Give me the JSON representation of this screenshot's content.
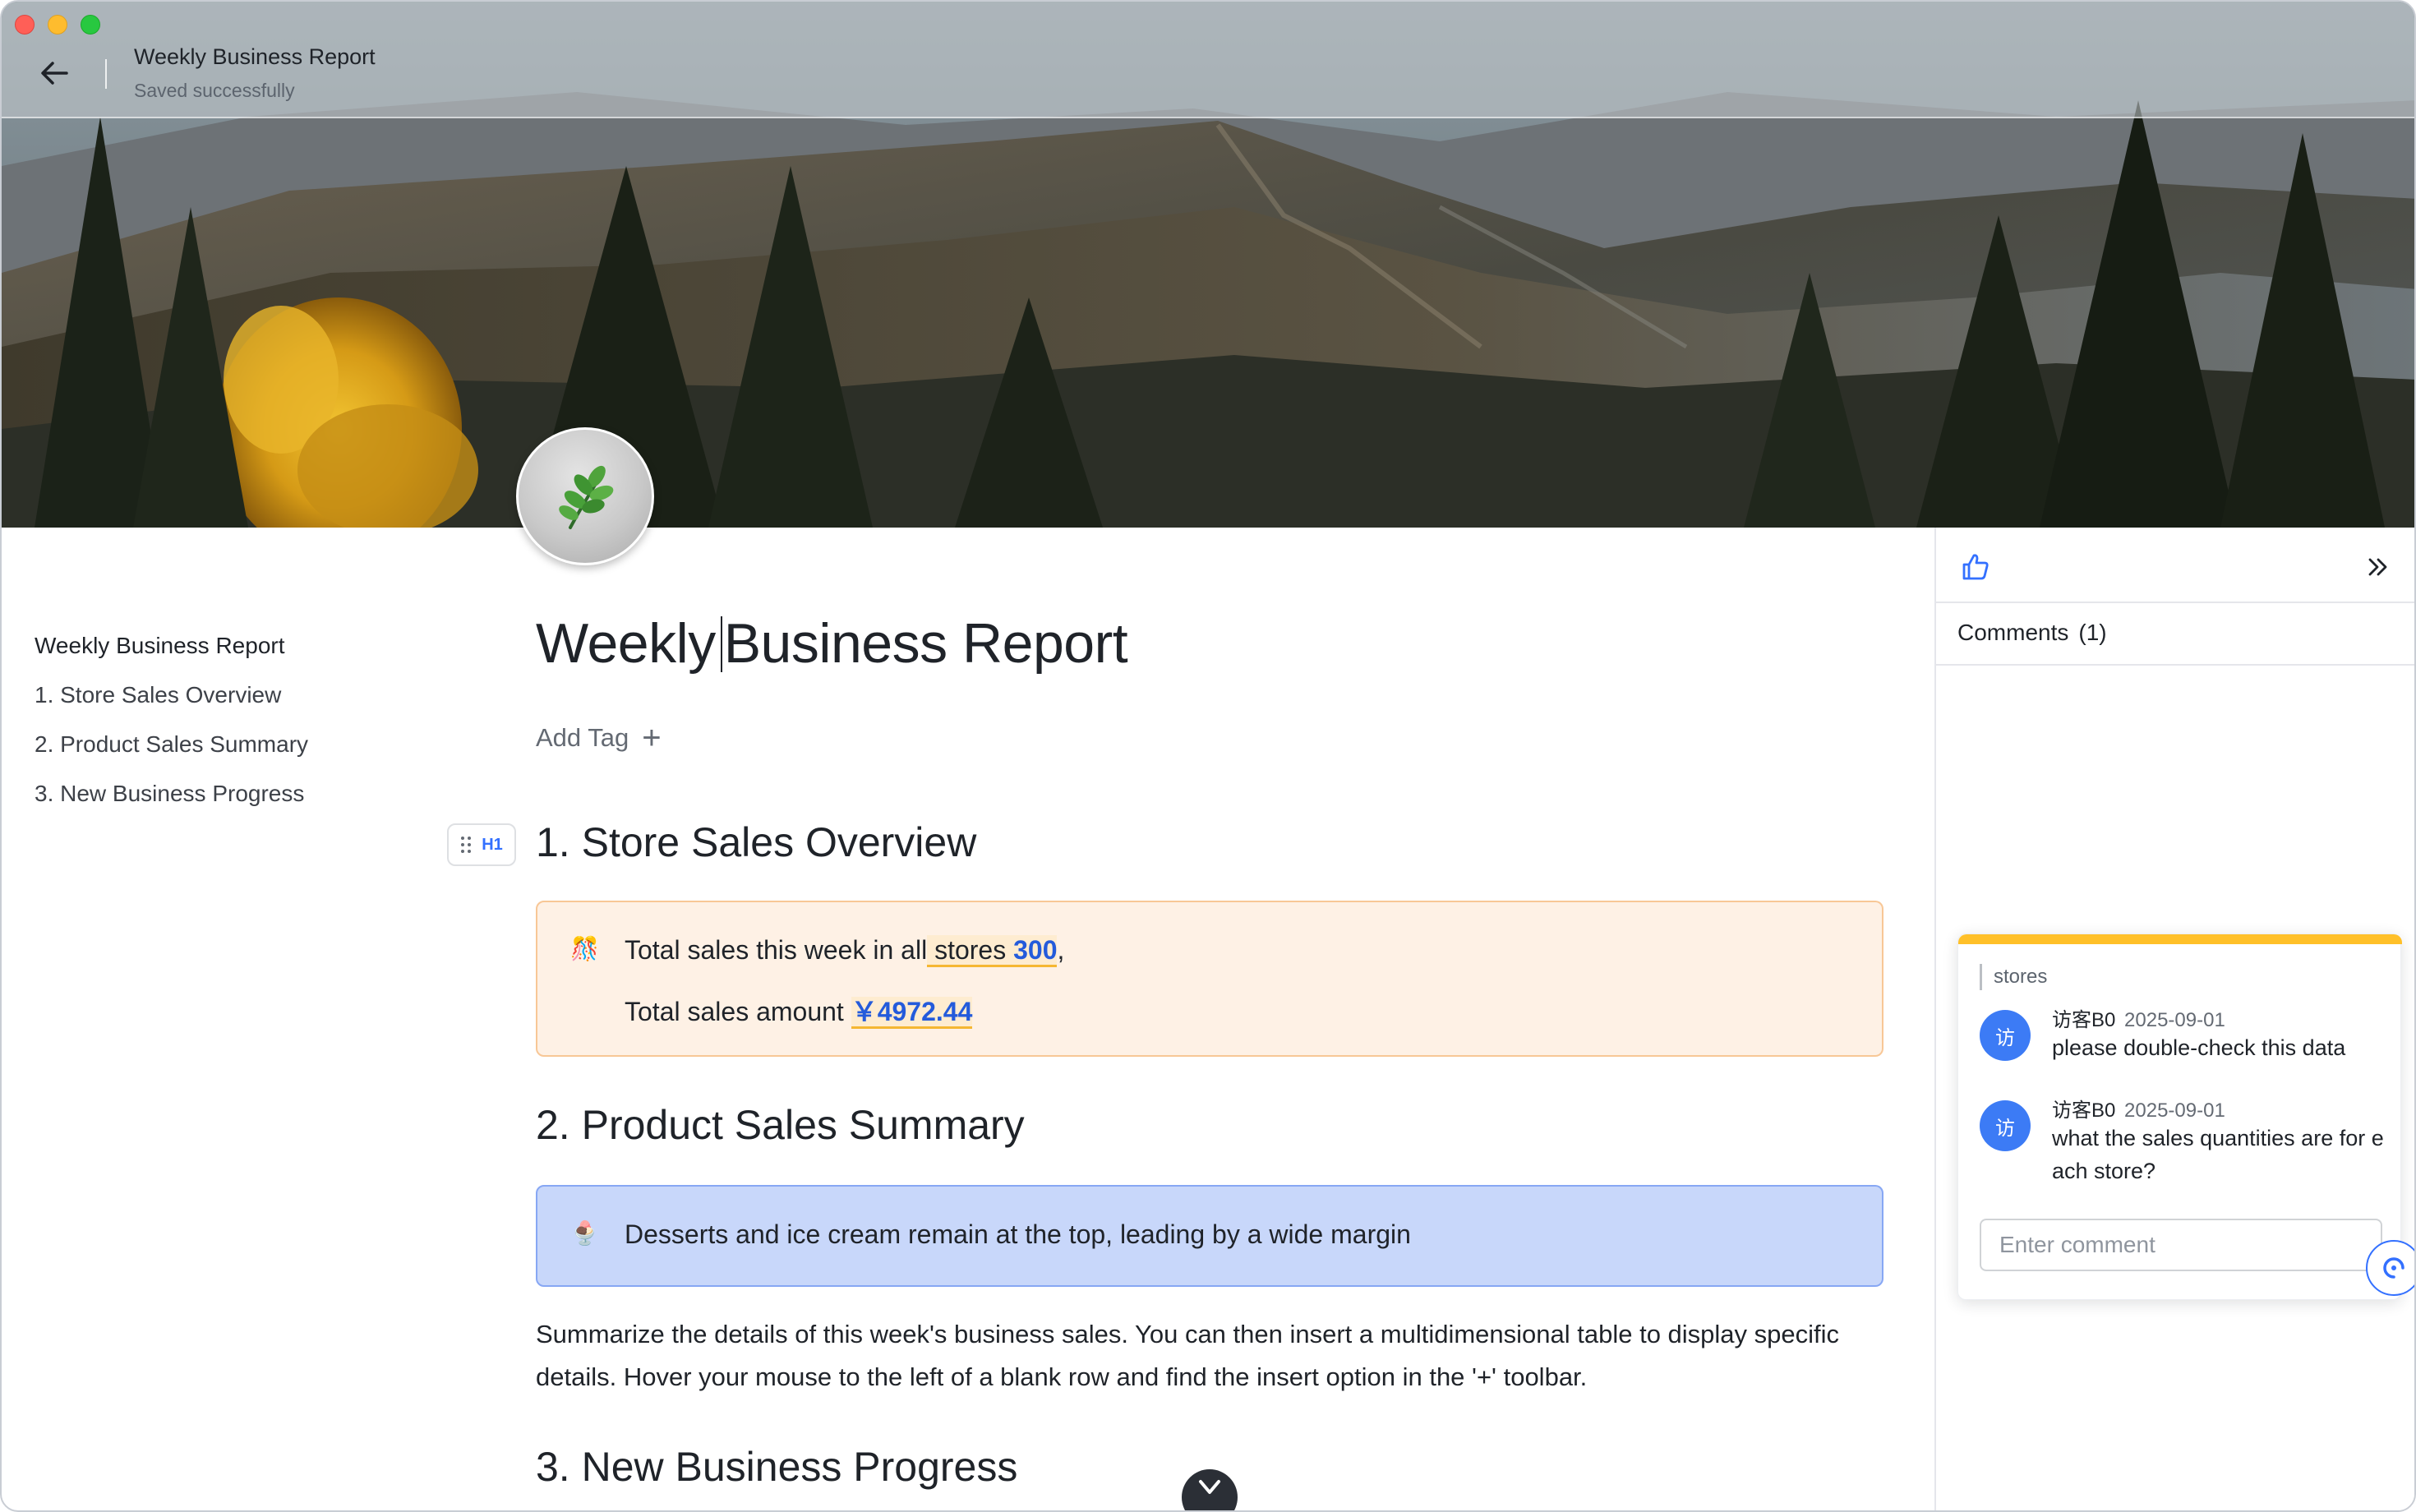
{
  "window": {
    "title": "Weekly Business Report",
    "status": "Saved successfully"
  },
  "icons": {
    "back": "arrow-left-icon",
    "doc_icon": "herb-icon",
    "like": "thumbs-up-icon",
    "collapse": "double-chevron-right-icon",
    "scroll_down": "chevron-down-icon",
    "callout_1": "gift-emoji-icon",
    "callout_2": "dessert-emoji-icon"
  },
  "colors": {
    "accent": "#3370ff",
    "number": "#245bdb",
    "callout_orange_bg": "#fef1e5",
    "callout_blue_bg": "#c8d7fa",
    "comment_bar": "#ffc029"
  },
  "outline": {
    "items": [
      "Weekly Business Report",
      "1. Store Sales Overview",
      "2. Product Sales Summary",
      "3. New Business Progress"
    ]
  },
  "document": {
    "title_part1": "Weekly",
    "title_part2": "Business Report",
    "add_tag": "Add Tag",
    "add_tag_plus": "+",
    "handle_label": "H1",
    "section1": {
      "heading": "1. Store Sales Overview",
      "line1_prefix": "Total sales this week in all",
      "line1_highlight": " stores ",
      "line1_value": "300",
      "line1_suffix": ",",
      "line2_prefix": "Total sales amount",
      "line2_value": "￥4972.44"
    },
    "section2": {
      "heading": "2. Product Sales Summary",
      "callout": "Desserts and ice cream remain at the top, leading by a wide margin",
      "paragraph": "Summarize the details of this week's business sales. You can then insert a multidimensional table to display specific details. Hover your mouse to the left of a blank row and find the insert option in the '+' toolbar."
    },
    "section3": {
      "heading": "3. New Business Progress"
    }
  },
  "comments_panel": {
    "label": "Comments",
    "count": "(1)",
    "quote": "stores",
    "input_placeholder": "Enter comment",
    "items": [
      {
        "avatar": "访",
        "author": "访客B0",
        "date": "2025-09-01",
        "text": "please double-check this data"
      },
      {
        "avatar": "访",
        "author": "访客B0",
        "date": "2025-09-01",
        "text": "what the sales quantities are for each store?"
      }
    ]
  }
}
